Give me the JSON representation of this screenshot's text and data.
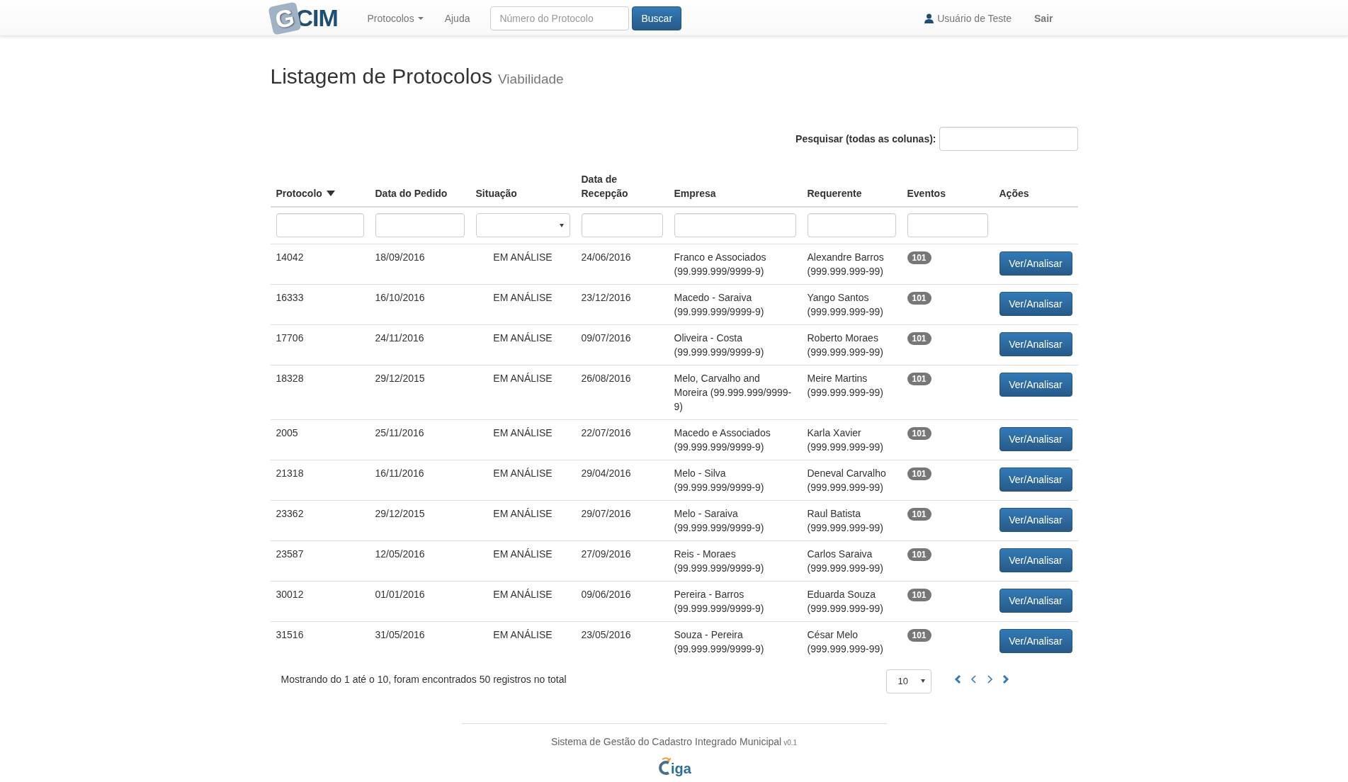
{
  "navbar": {
    "logo": {
      "initial": "G",
      "text": "CIM"
    },
    "menu": [
      {
        "label": "Protocolos",
        "kind": "dropdown"
      },
      {
        "label": "Ajuda",
        "kind": "link"
      }
    ],
    "search": {
      "placeholder": "Número do Protocolo",
      "button": "Buscar"
    },
    "user": "Usuário de Teste",
    "logout": "Sair"
  },
  "page": {
    "title": "Listagem de Protocolos",
    "subtitle": "Viabilidade"
  },
  "global_search": {
    "label": "Pesquisar (todas as colunas):"
  },
  "table": {
    "columns": [
      {
        "label": "Protocolo",
        "sorted": true
      },
      {
        "label": "Data do Pedido",
        "sorted": false
      },
      {
        "label": "Situação",
        "sorted": false
      },
      {
        "label": "Data de Recepção",
        "sorted": false
      },
      {
        "label": "Empresa",
        "sorted": false
      },
      {
        "label": "Requerente",
        "sorted": false
      },
      {
        "label": "Eventos",
        "sorted": false
      },
      {
        "label": "Ações",
        "sorted": false
      }
    ],
    "filters": [
      {
        "kind": "text"
      },
      {
        "kind": "text"
      },
      {
        "kind": "select"
      },
      {
        "kind": "text"
      },
      {
        "kind": "text"
      },
      {
        "kind": "text"
      },
      {
        "kind": "text"
      },
      {
        "kind": "none"
      }
    ],
    "rows": [
      {
        "protocolo": "14042",
        "data_pedido": "18/09/2016",
        "situacao": "EM ANÁLISE",
        "data_recepcao": "24/06/2016",
        "empresa": "Franco e Associados (99.999.999/9999-9)",
        "requerente": "Alexandre Barros (999.999.999-99)",
        "eventos": "101",
        "action": "Ver/Analisar"
      },
      {
        "protocolo": "16333",
        "data_pedido": "16/10/2016",
        "situacao": "EM ANÁLISE",
        "data_recepcao": "23/12/2016",
        "empresa": "Macedo - Saraiva (99.999.999/9999-9)",
        "requerente": "Yango Santos (999.999.999-99)",
        "eventos": "101",
        "action": "Ver/Analisar"
      },
      {
        "protocolo": "17706",
        "data_pedido": "24/11/2016",
        "situacao": "EM ANÁLISE",
        "data_recepcao": "09/07/2016",
        "empresa": "Oliveira - Costa (99.999.999/9999-9)",
        "requerente": "Roberto Moraes (999.999.999-99)",
        "eventos": "101",
        "action": "Ver/Analisar"
      },
      {
        "protocolo": "18328",
        "data_pedido": "29/12/2015",
        "situacao": "EM ANÁLISE",
        "data_recepcao": "26/08/2016",
        "empresa": "Melo, Carvalho and Moreira (99.999.999/9999-9)",
        "requerente": "Meire Martins (999.999.999-99)",
        "eventos": "101",
        "action": "Ver/Analisar"
      },
      {
        "protocolo": "2005",
        "data_pedido": "25/11/2016",
        "situacao": "EM ANÁLISE",
        "data_recepcao": "22/07/2016",
        "empresa": "Macedo e Associados (99.999.999/9999-9)",
        "requerente": "Karla Xavier (999.999.999-99)",
        "eventos": "101",
        "action": "Ver/Analisar"
      },
      {
        "protocolo": "21318",
        "data_pedido": "16/11/2016",
        "situacao": "EM ANÁLISE",
        "data_recepcao": "29/04/2016",
        "empresa": "Melo - Silva (99.999.999/9999-9)",
        "requerente": "Deneval Carvalho (999.999.999-99)",
        "eventos": "101",
        "action": "Ver/Analisar"
      },
      {
        "protocolo": "23362",
        "data_pedido": "29/12/2015",
        "situacao": "EM ANÁLISE",
        "data_recepcao": "29/07/2016",
        "empresa": "Melo - Saraiva (99.999.999/9999-9)",
        "requerente": "Raul Batista (999.999.999-99)",
        "eventos": "101",
        "action": "Ver/Analisar"
      },
      {
        "protocolo": "23587",
        "data_pedido": "12/05/2016",
        "situacao": "EM ANÁLISE",
        "data_recepcao": "27/09/2016",
        "empresa": "Reis - Moraes (99.999.999/9999-9)",
        "requerente": "Carlos Saraiva (999.999.999-99)",
        "eventos": "101",
        "action": "Ver/Analisar"
      },
      {
        "protocolo": "30012",
        "data_pedido": "01/01/2016",
        "situacao": "EM ANÁLISE",
        "data_recepcao": "09/06/2016",
        "empresa": "Pereira - Barros (99.999.999/9999-9)",
        "requerente": "Eduarda Souza (999.999.999-99)",
        "eventos": "101",
        "action": "Ver/Analisar"
      },
      {
        "protocolo": "31516",
        "data_pedido": "31/05/2016",
        "situacao": "EM ANÁLISE",
        "data_recepcao": "23/05/2016",
        "empresa": "Souza - Pereira (99.999.999/9999-9)",
        "requerente": "César Melo (999.999.999-99)",
        "eventos": "101",
        "action": "Ver/Analisar"
      }
    ]
  },
  "table_info": "Mostrando do 1 até o 10, foram encontrados 50 registros no total",
  "page_size": "10",
  "footer": {
    "text": "Sistema de Gestão do Cadastro Integrado Municipal",
    "version": "v0.1",
    "logo_text": "iga"
  }
}
